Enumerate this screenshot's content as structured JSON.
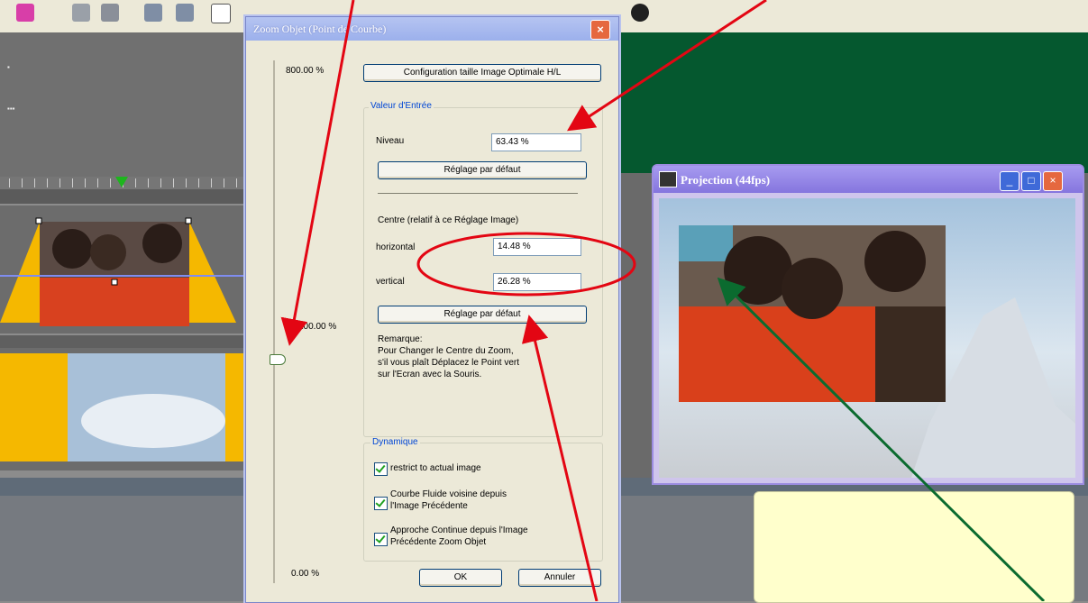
{
  "dialog": {
    "title": "Zoom Objet (Point de Courbe)",
    "close_label": "×",
    "scale_top": "800.00 %",
    "scale_mid": "100.00 %",
    "scale_bottom": "0.00 %",
    "config_button": "Configuration taille Image Optimale H/L",
    "input_group_title": "Valeur d'Entrée",
    "level_label": "Niveau",
    "level_value": "63.43 %",
    "default_button_1": "Réglage par défaut",
    "center_title": "Centre (relatif à ce Réglage Image)",
    "horizontal_label": "horizontal",
    "horizontal_value": "14.48 %",
    "vertical_label": "vertical",
    "vertical_value": "26.28 %",
    "default_button_2": "Réglage par défaut",
    "remark_title": "Remarque:",
    "remark_lines": [
      "Pour Changer le Centre du Zoom,",
      "s'il vous plaît Déplacez le Point vert",
      "sur l'Ecran avec la Souris."
    ],
    "dynamic_title": "Dynamique",
    "checkbox_1": "restrict to actual image",
    "checkbox_2_lines": [
      "Courbe Fluide voisine depuis",
      "l'Image Précédente"
    ],
    "checkbox_3_lines": [
      "Approche Continue depuis l'Image",
      "Précédente Zoom Objet"
    ],
    "ok_button": "OK",
    "cancel_button": "Annuler"
  },
  "projection": {
    "title": "Projection (44fps)",
    "minimize": "_",
    "maximize": "□",
    "close": "×"
  },
  "colors": {
    "annotation_red": "#e30613",
    "annotation_green": "#0b6b2f",
    "green_area": "#05582f",
    "track_yellow": "#f5b800"
  }
}
